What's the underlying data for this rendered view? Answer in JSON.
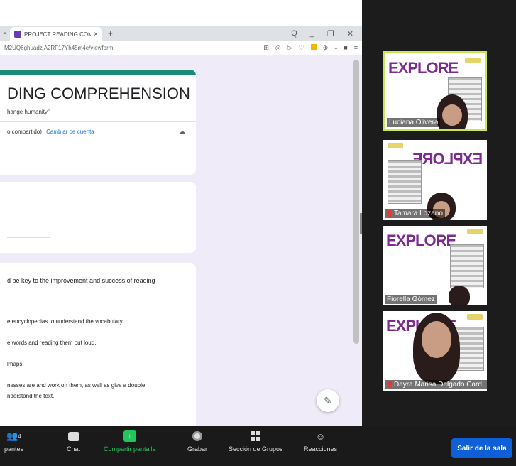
{
  "browser": {
    "tab_title": "PROJECT READING COMP",
    "url": "M2UQ6ghuadzjA2RF17Yh45m4e/viewform",
    "tab_close": "×",
    "tab_left_close": "×",
    "new_tab": "+",
    "win_controls": {
      "search": "Q",
      "minimize": "_",
      "restore": "❐",
      "close": "✕"
    }
  },
  "form": {
    "title": "DING COMPREHENSION",
    "subtitle": "hange humanity\"",
    "account_status": "o compartido)",
    "switch_account": "Cambiar de cuenta",
    "question": "d be key to the improvement and success of reading",
    "options": [
      "e encyclopedias to understand the vocabulary.",
      "e words and reading them out loud.",
      "lmaps.",
      "nesses are and work on them, as well as give a double",
      "nderstand the text."
    ]
  },
  "participants": [
    {
      "name": "Luciana Olivera",
      "active": true,
      "muted": false,
      "logo": "EXPLORE"
    },
    {
      "name": "Tamara Lozano",
      "active": false,
      "muted": true,
      "logo": "EXPLORE"
    },
    {
      "name": "Fiorella Gómez",
      "active": false,
      "muted": false,
      "logo": "EXPLORE"
    },
    {
      "name": "Dayra Marisa Delgado Card...",
      "active": false,
      "muted": true,
      "logo": "EXPLORE"
    }
  ],
  "toolbar": {
    "participants_count": "4",
    "participants_label": "pantes",
    "chat_label": "Chat",
    "share_label": "Compartir pantalla",
    "record_label": "Grabar",
    "breakout_label": "Sección de Grupos",
    "reactions_label": "Reacciones",
    "leave_label": "Salir de la sala"
  },
  "colors": {
    "form_accent": "#1a8a7a",
    "share_green": "#22c55e",
    "leave_blue": "#0e5fd8",
    "active_border": "#c8e65a",
    "form_bg": "#f0ebf8"
  }
}
